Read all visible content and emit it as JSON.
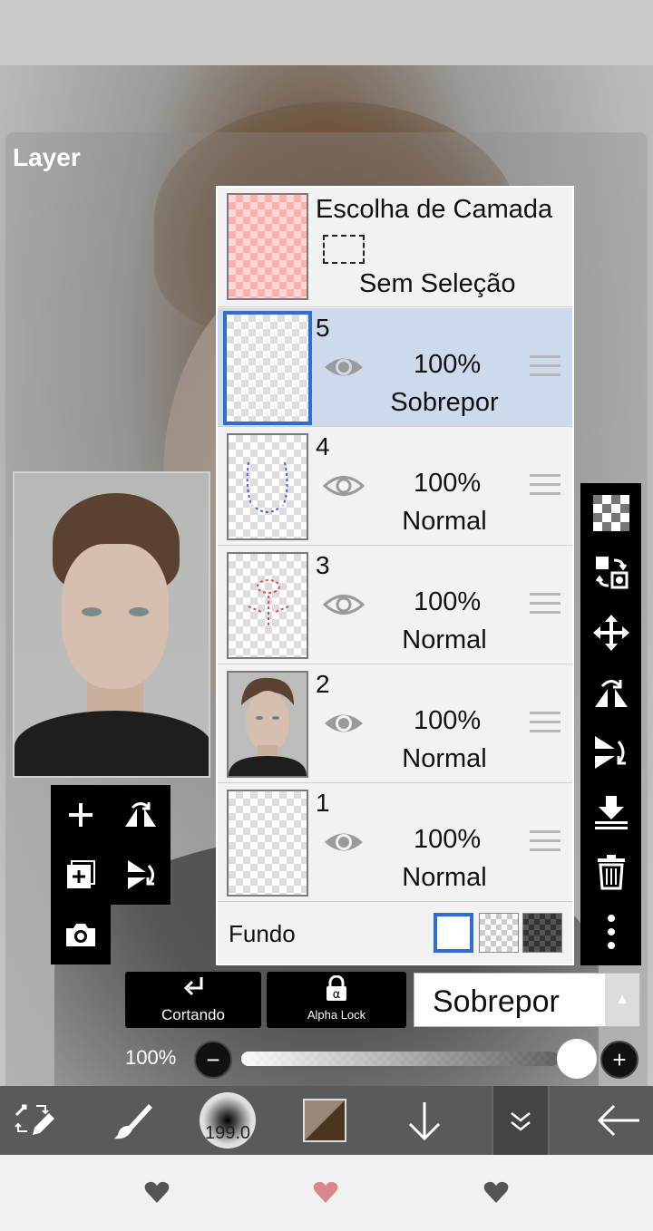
{
  "panel": {
    "title": "Layer"
  },
  "selection": {
    "title": "Escolha de Camada",
    "status": "Sem Seleção"
  },
  "layers": [
    {
      "num": "5",
      "opacity": "100%",
      "blend": "Sobrepor",
      "active": true
    },
    {
      "num": "4",
      "opacity": "100%",
      "blend": "Normal"
    },
    {
      "num": "3",
      "opacity": "100%",
      "blend": "Normal"
    },
    {
      "num": "2",
      "opacity": "100%",
      "blend": "Normal"
    },
    {
      "num": "1",
      "opacity": "100%",
      "blend": "Normal"
    }
  ],
  "fundo": {
    "label": "Fundo"
  },
  "actions": {
    "clipping": "Cortando",
    "alpha_lock": "Alpha Lock"
  },
  "blend_mode": {
    "value": "Sobrepor"
  },
  "opacity": {
    "label": "100%",
    "value": 1.0
  },
  "brush": {
    "size": "199.0"
  },
  "colors": {
    "accent": "#2d6fd1",
    "active_row": "#cddaee",
    "nav_heart_mid": "#d9878f",
    "nav_heart": "#555555"
  },
  "icons": {
    "left_tools": [
      "plus-icon",
      "flip-horizontal-icon",
      "add-copy-icon",
      "flip-vertical-icon",
      "camera-icon"
    ],
    "right_tools": [
      "checker-icon",
      "transform-icon",
      "move-icon",
      "flip-h-icon",
      "flip-v-icon",
      "merge-down-icon",
      "trash-icon",
      "more-icon"
    ],
    "bottom": [
      "swap-tool-icon",
      "brush-icon",
      "brush-size",
      "color-swatch",
      "arrow-down-icon",
      "chevron-double-down-icon",
      "back-arrow-icon"
    ]
  }
}
